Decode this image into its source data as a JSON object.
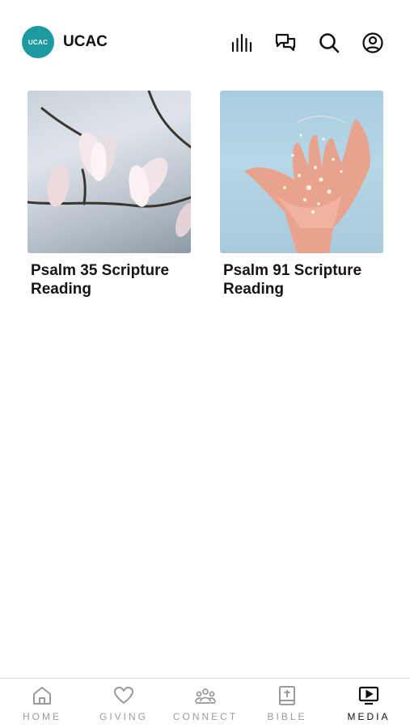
{
  "header": {
    "logo_text": "UCAC",
    "title": "UCAC",
    "icons": [
      "audio-bars-icon",
      "chat-icon",
      "search-icon",
      "profile-icon"
    ]
  },
  "media": {
    "items": [
      {
        "title": "Psalm 35 Scripture Reading",
        "image": "magnolia-blossoms-photo"
      },
      {
        "title": "Psalm 91 Scripture Reading",
        "image": "hands-fairy-lights-photo"
      }
    ]
  },
  "tabbar": {
    "tabs": [
      {
        "label": "HOME",
        "icon": "home-icon"
      },
      {
        "label": "GIVING",
        "icon": "heart-icon"
      },
      {
        "label": "CONNECT",
        "icon": "people-icon"
      },
      {
        "label": "BIBLE",
        "icon": "bible-icon"
      },
      {
        "label": "MEDIA",
        "icon": "tv-play-icon"
      }
    ],
    "active": "MEDIA"
  },
  "colors": {
    "brand": "#1d9aa0",
    "inactive": "#9a9a9a",
    "active": "#111111"
  }
}
